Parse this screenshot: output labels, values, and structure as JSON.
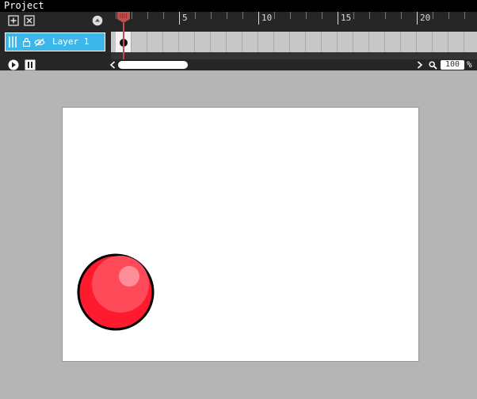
{
  "app": {
    "title": "Project"
  },
  "timeline": {
    "ruler_labels": [
      {
        "frame": 5,
        "text": "5"
      },
      {
        "frame": 10,
        "text": "10"
      },
      {
        "frame": 15,
        "text": "15"
      },
      {
        "frame": 20,
        "text": "20"
      }
    ],
    "current_frame": 1,
    "layers": [
      {
        "name": "Layer 1",
        "locked": false,
        "hidden": false
      }
    ],
    "zoom": {
      "value": "100",
      "unit": "%"
    }
  },
  "icons": {
    "add_layer": "add-layer-icon",
    "delete_layer": "delete-layer-icon",
    "onion_skin": "onion-skin-icon",
    "play": "play-icon",
    "pause": "pause-icon",
    "lock": "lock-icon",
    "eye": "eye-hidden-icon",
    "search": "magnifier-icon"
  },
  "colors": {
    "playhead": "#c0504d",
    "layer_selected": "#3db7ea",
    "ball_fill": "#ff1a2e",
    "ball_outline": "#000000"
  }
}
